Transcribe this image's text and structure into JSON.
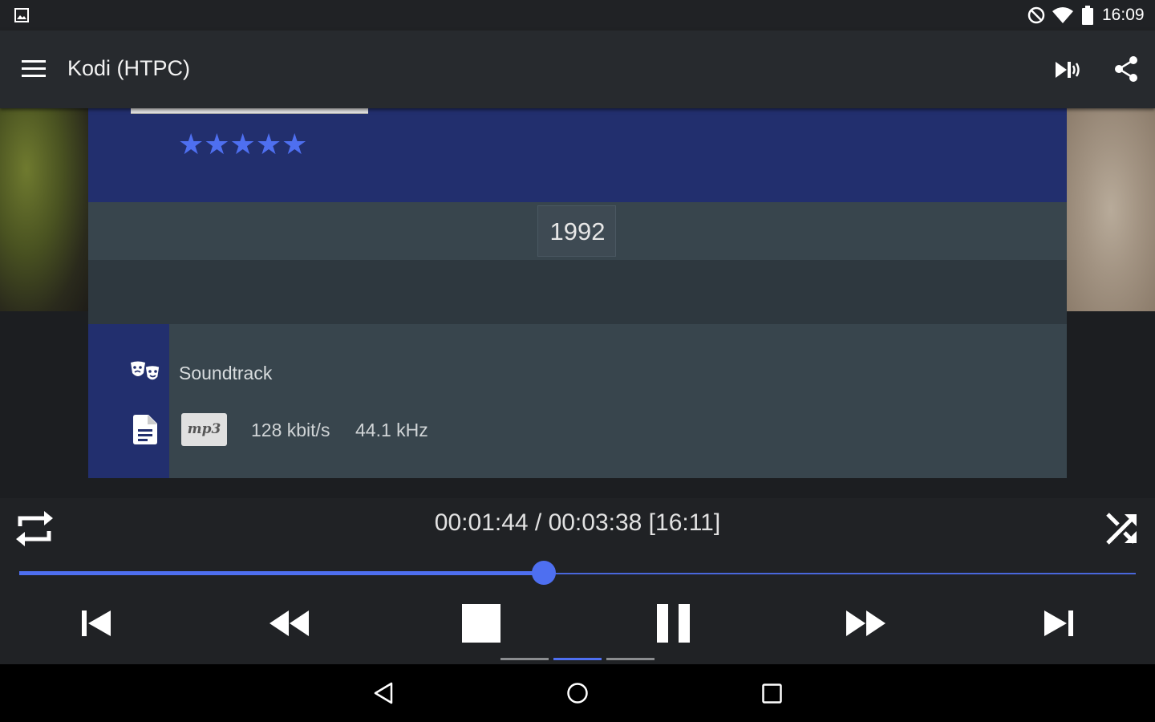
{
  "status_bar": {
    "time": "16:09",
    "icons": [
      "image-notification-icon",
      "do-not-disturb-icon",
      "wifi-icon",
      "battery-icon"
    ]
  },
  "app_bar": {
    "title": "Kodi (HTPC)",
    "icons": [
      "menu-icon",
      "audio-output-icon",
      "share-icon"
    ]
  },
  "album": {
    "rating": "★★★★★",
    "rating_value": 5,
    "rating_max": 5,
    "year": "1992",
    "genre": "Soundtrack",
    "format_badge": "mp3",
    "bitrate": "128 kbit/s",
    "samplerate": "44.1 kHz"
  },
  "player": {
    "time_display": "00:01:44 / 00:03:38 [16:11]",
    "progress_fraction": 0.47,
    "controls": [
      "repeat-icon",
      "shuffle-icon",
      "skip-previous-icon",
      "rewind-icon",
      "stop-icon",
      "pause-icon",
      "fast-forward-icon",
      "skip-next-icon"
    ],
    "page_indicator": {
      "pages": 3,
      "active": 2
    }
  },
  "nav_bar": {
    "icons": [
      "back-icon",
      "home-icon",
      "recents-icon"
    ]
  },
  "colors": {
    "accent": "#4e6ff0",
    "card_band": "#222f6e",
    "card_bg": "#38454d",
    "app_bar": "#272a2e"
  }
}
